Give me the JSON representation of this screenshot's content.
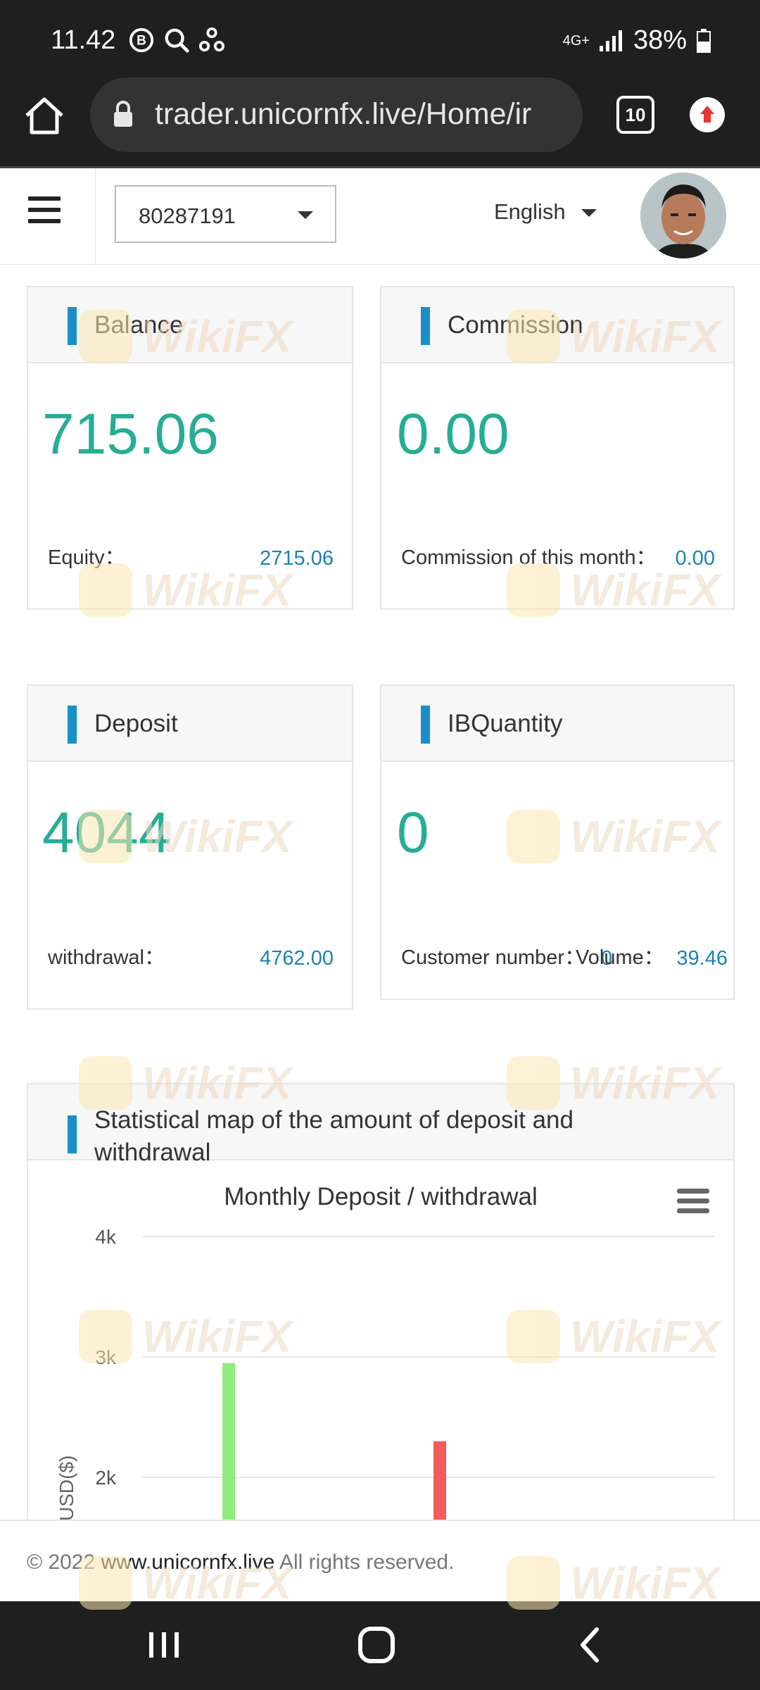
{
  "status_bar": {
    "time": "11.42",
    "network": "4G+",
    "battery": "38%",
    "left_icons": [
      "b-badge-icon",
      "search-icon",
      "sync-icon"
    ]
  },
  "browser": {
    "url": "trader.unicornfx.live/Home/ir",
    "tab_count": "10"
  },
  "header": {
    "account_number": "80287191",
    "language": "English"
  },
  "cards": {
    "balance": {
      "title": "Balance",
      "value": "715.06",
      "foot_label": "Equity：",
      "foot_value": "2715.06"
    },
    "commission": {
      "title": "Commission",
      "value": "0.00",
      "foot_label": "Commission of this month：",
      "foot_value": "0.00"
    },
    "deposit": {
      "title": "Deposit",
      "value": "4044",
      "foot_label": "withdrawal：",
      "foot_value": "4762.00"
    },
    "ibquantity": {
      "title": "IBQuantity",
      "value": "0",
      "foot_label": "Customer number：",
      "foot_value_a": "0",
      "foot_label_b": "Volume：",
      "foot_value_b": "39.46"
    }
  },
  "chart_panel": {
    "heading": "Statistical map of the amount of deposit and withdrawal"
  },
  "chart_data": {
    "type": "bar",
    "title": "Monthly Deposit / withdrawal",
    "ylabel": "USD($)",
    "y_ticks": [
      "4k",
      "3k",
      "2k"
    ],
    "ylim_visible": [
      2000,
      4000
    ],
    "series": [
      {
        "values": [
          2950
        ],
        "color": "#90ed7d"
      },
      {
        "values": [
          2300
        ],
        "color": "#f45b5b"
      }
    ]
  },
  "footer": {
    "copyright": "© 2022",
    "link": "www.unicornfx.live",
    "rights": "All rights reserved."
  },
  "watermark": "WikiFX"
}
